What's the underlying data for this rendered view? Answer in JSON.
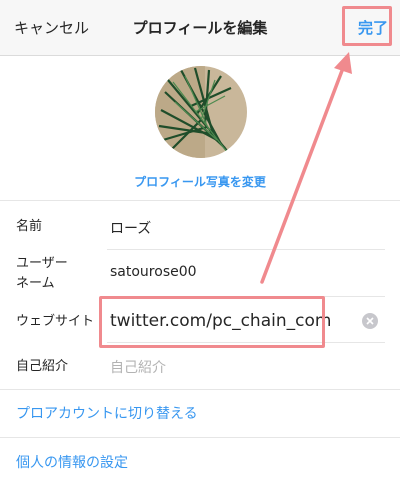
{
  "nav": {
    "cancel": "キャンセル",
    "title": "プロフィールを編集",
    "done": "完了"
  },
  "profile": {
    "change_photo": "プロフィール写真を変更"
  },
  "fields": {
    "name": {
      "label": "名前",
      "value": "ローズ"
    },
    "username": {
      "label_line1": "ユーザー",
      "label_line2": "ネーム",
      "value": "satourose00"
    },
    "website": {
      "label": "ウェブサイト",
      "value": "twitter.com/pc_chain_com"
    },
    "bio": {
      "label": "自己紹介",
      "placeholder": "自己紹介"
    }
  },
  "links": {
    "pro_account": "プロアカウントに切り替える",
    "personal_info": "個人の情報の設定"
  },
  "colors": {
    "accent": "#3897f0",
    "annotation": "#f08a8e"
  },
  "icons": {
    "clear": "clear-circle-icon"
  }
}
